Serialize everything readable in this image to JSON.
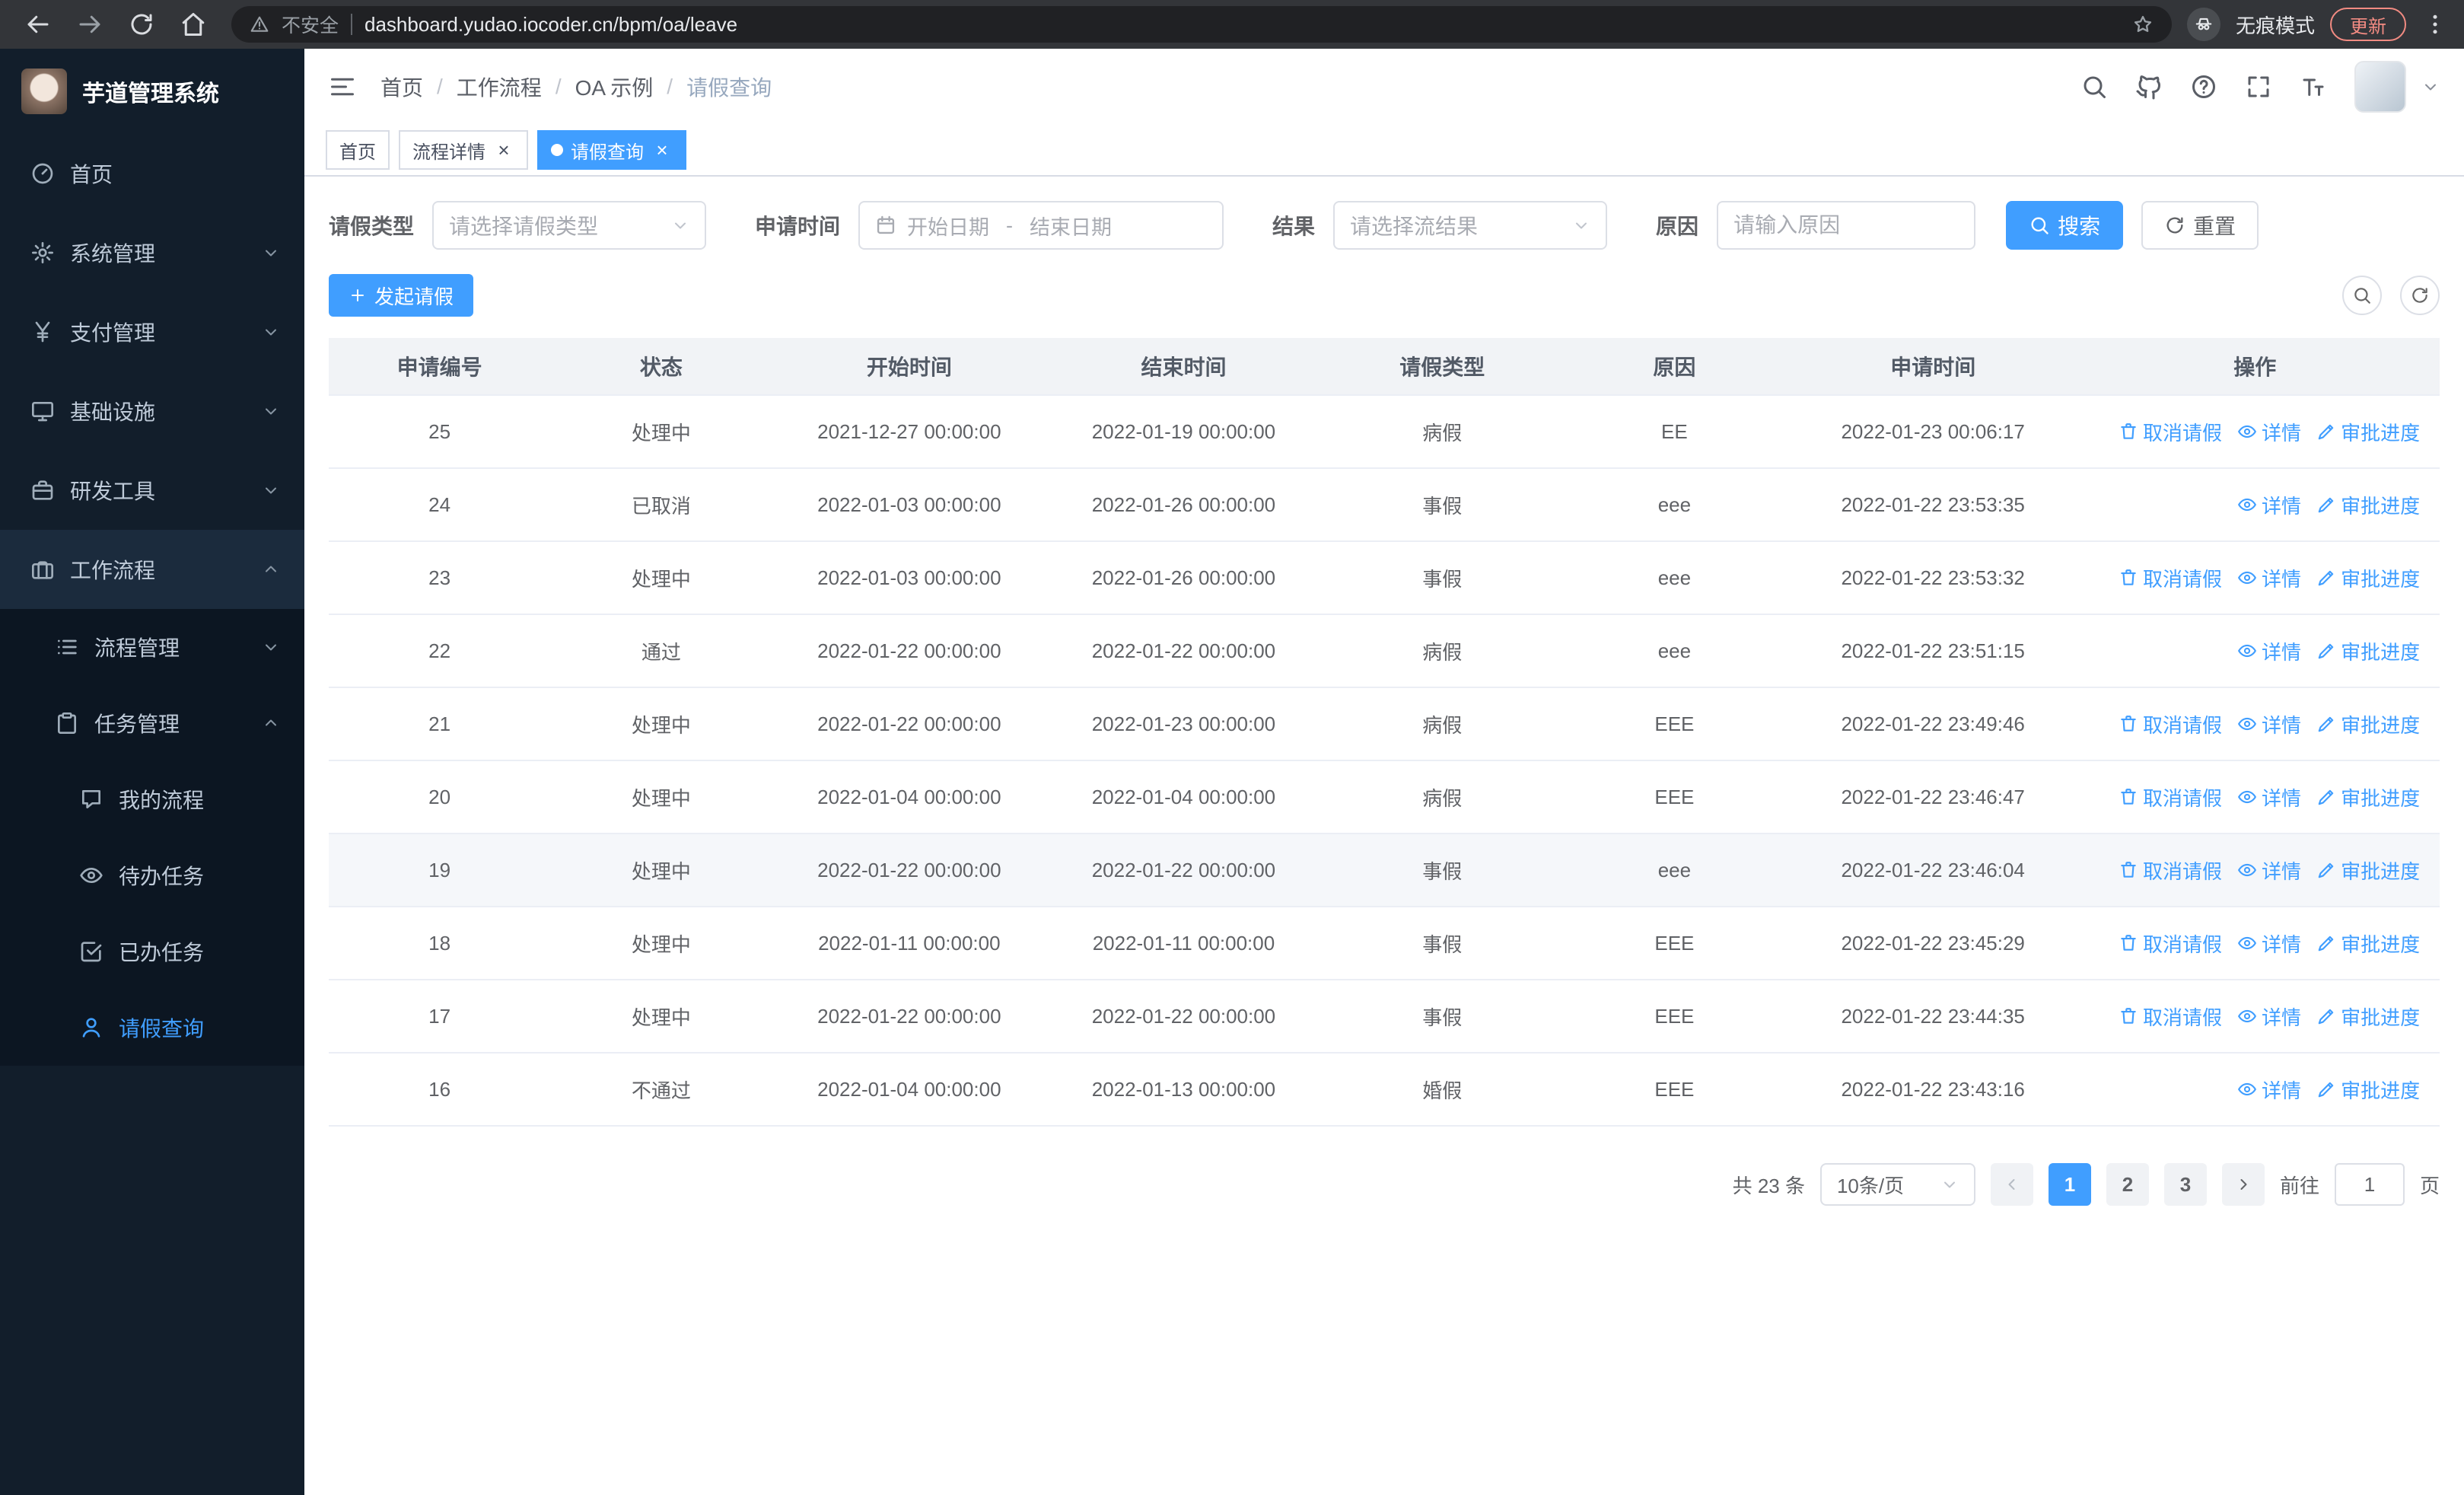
{
  "colors": {
    "primary": "#409eff",
    "sidebar_bg": "#121e2b",
    "sidebar_active": "#409eff",
    "tab_active_bg": "#409eff"
  },
  "browser": {
    "security_label": "不安全",
    "url": "dashboard.yudao.iocoder.cn/bpm/oa/leave",
    "incognito_label": "无痕模式",
    "update_label": "更新"
  },
  "sidebar": {
    "app_title": "芋道管理系统",
    "menu": [
      {
        "id": "home",
        "label": "首页",
        "icon": "dashboard",
        "level": 1
      },
      {
        "id": "system",
        "label": "系统管理",
        "icon": "gear",
        "level": 1,
        "expand": "down"
      },
      {
        "id": "payment",
        "label": "支付管理",
        "icon": "yen",
        "level": 1,
        "expand": "down"
      },
      {
        "id": "infra",
        "label": "基础设施",
        "icon": "monitor",
        "level": 1,
        "expand": "down"
      },
      {
        "id": "devtools",
        "label": "研发工具",
        "icon": "toolbox",
        "level": 1,
        "expand": "down"
      },
      {
        "id": "workflow",
        "label": "工作流程",
        "icon": "briefcase",
        "level": 1,
        "expand": "up",
        "open": true
      },
      {
        "id": "process-mgmt",
        "label": "流程管理",
        "icon": "list",
        "level": 2,
        "expand": "down"
      },
      {
        "id": "task-mgmt",
        "label": "任务管理",
        "icon": "clipboard",
        "level": 2,
        "expand": "up",
        "open": true
      },
      {
        "id": "my-process",
        "label": "我的流程",
        "icon": "chat",
        "level": 3
      },
      {
        "id": "todo-task",
        "label": "待办任务",
        "icon": "eye",
        "level": 3
      },
      {
        "id": "done-task",
        "label": "已办任务",
        "icon": "check-square",
        "level": 3
      },
      {
        "id": "leave-query",
        "label": "请假查询",
        "icon": "user",
        "level": 3,
        "active": true
      }
    ]
  },
  "header": {
    "breadcrumb": [
      "首页",
      "工作流程",
      "OA 示例",
      "请假查询"
    ]
  },
  "tabs": [
    {
      "id": "home",
      "label": "首页",
      "closable": false,
      "active": false
    },
    {
      "id": "process-detail",
      "label": "流程详情",
      "closable": true,
      "active": false
    },
    {
      "id": "leave-query",
      "label": "请假查询",
      "closable": true,
      "active": true
    }
  ],
  "filters": {
    "leave_type_label": "请假类型",
    "leave_type_placeholder": "请选择请假类型",
    "apply_time_label": "申请时间",
    "start_date_placeholder": "开始日期",
    "range_separator": "-",
    "end_date_placeholder": "结束日期",
    "result_label": "结果",
    "result_placeholder": "请选择流结果",
    "reason_label": "原因",
    "reason_placeholder": "请输入原因",
    "search_label": "搜索",
    "reset_label": "重置"
  },
  "toolbar": {
    "create_label": "发起请假"
  },
  "table": {
    "columns": [
      "申请编号",
      "状态",
      "开始时间",
      "结束时间",
      "请假类型",
      "原因",
      "申请时间",
      "操作"
    ],
    "actions": {
      "cancel": "取消请假",
      "detail": "详情",
      "progress": "审批进度"
    },
    "rows": [
      {
        "id": "25",
        "status": "处理中",
        "start": "2021-12-27 00:00:00",
        "end": "2022-01-19 00:00:00",
        "type": "病假",
        "reason": "EE",
        "applied": "2022-01-23 00:06:17",
        "can_cancel": true,
        "highlighted": false
      },
      {
        "id": "24",
        "status": "已取消",
        "start": "2022-01-03 00:00:00",
        "end": "2022-01-26 00:00:00",
        "type": "事假",
        "reason": "eee",
        "applied": "2022-01-22 23:53:35",
        "can_cancel": false,
        "highlighted": false
      },
      {
        "id": "23",
        "status": "处理中",
        "start": "2022-01-03 00:00:00",
        "end": "2022-01-26 00:00:00",
        "type": "事假",
        "reason": "eee",
        "applied": "2022-01-22 23:53:32",
        "can_cancel": true,
        "highlighted": false
      },
      {
        "id": "22",
        "status": "通过",
        "start": "2022-01-22 00:00:00",
        "end": "2022-01-22 00:00:00",
        "type": "病假",
        "reason": "eee",
        "applied": "2022-01-22 23:51:15",
        "can_cancel": false,
        "highlighted": false
      },
      {
        "id": "21",
        "status": "处理中",
        "start": "2022-01-22 00:00:00",
        "end": "2022-01-23 00:00:00",
        "type": "病假",
        "reason": "EEE",
        "applied": "2022-01-22 23:49:46",
        "can_cancel": true,
        "highlighted": false
      },
      {
        "id": "20",
        "status": "处理中",
        "start": "2022-01-04 00:00:00",
        "end": "2022-01-04 00:00:00",
        "type": "病假",
        "reason": "EEE",
        "applied": "2022-01-22 23:46:47",
        "can_cancel": true,
        "highlighted": false
      },
      {
        "id": "19",
        "status": "处理中",
        "start": "2022-01-22 00:00:00",
        "end": "2022-01-22 00:00:00",
        "type": "事假",
        "reason": "eee",
        "applied": "2022-01-22 23:46:04",
        "can_cancel": true,
        "highlighted": true
      },
      {
        "id": "18",
        "status": "处理中",
        "start": "2022-01-11 00:00:00",
        "end": "2022-01-11 00:00:00",
        "type": "事假",
        "reason": "EEE",
        "applied": "2022-01-22 23:45:29",
        "can_cancel": true,
        "highlighted": false
      },
      {
        "id": "17",
        "status": "处理中",
        "start": "2022-01-22 00:00:00",
        "end": "2022-01-22 00:00:00",
        "type": "事假",
        "reason": "EEE",
        "applied": "2022-01-22 23:44:35",
        "can_cancel": true,
        "highlighted": false
      },
      {
        "id": "16",
        "status": "不通过",
        "start": "2022-01-04 00:00:00",
        "end": "2022-01-13 00:00:00",
        "type": "婚假",
        "reason": "EEE",
        "applied": "2022-01-22 23:43:16",
        "can_cancel": false,
        "highlighted": false
      }
    ]
  },
  "pagination": {
    "total_label": "共 23 条",
    "page_size": "10条/页",
    "pages": [
      "1",
      "2",
      "3"
    ],
    "active_page": "1",
    "goto_label": "前往",
    "goto_value": "1",
    "goto_suffix": "页"
  }
}
